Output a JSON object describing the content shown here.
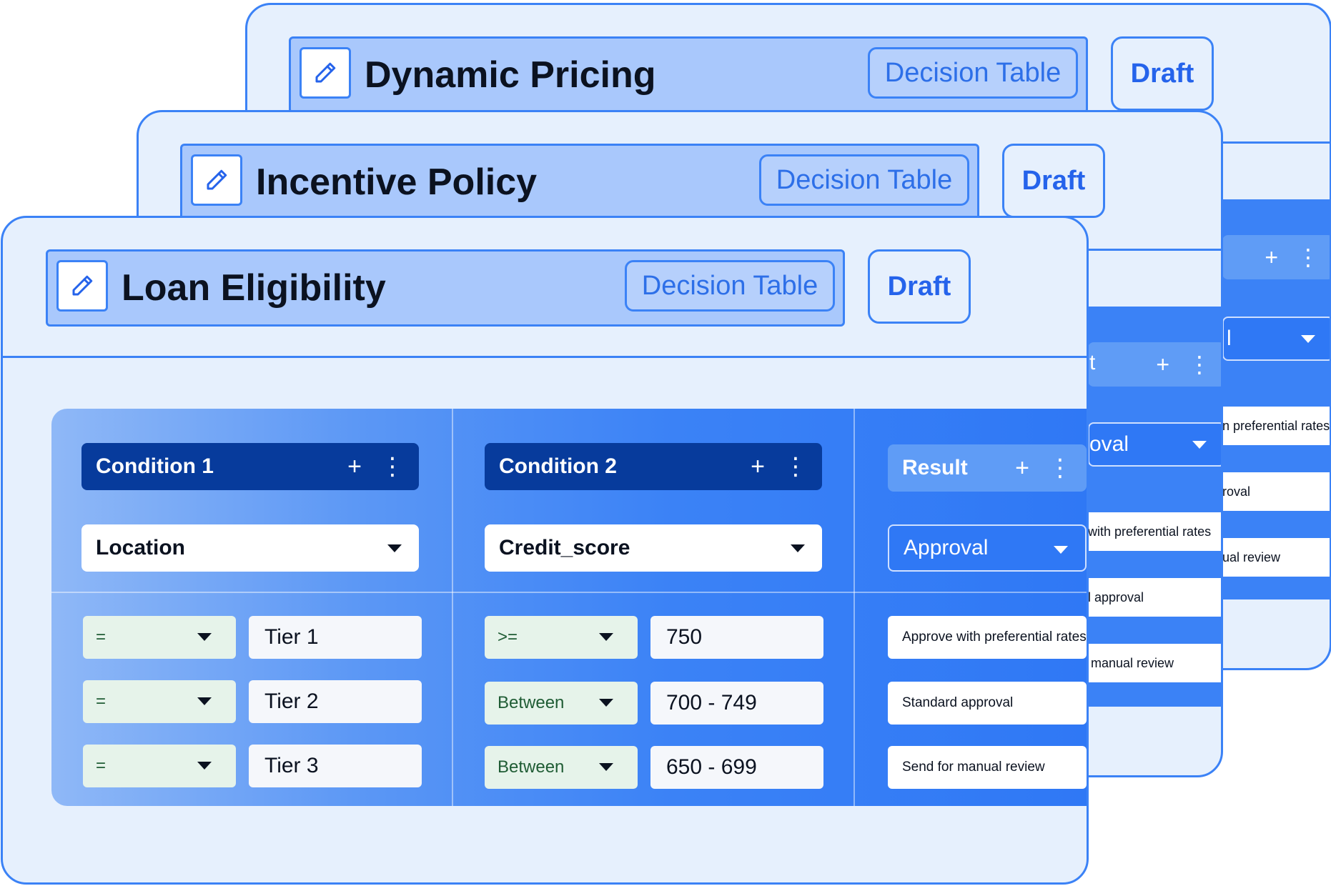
{
  "cards": {
    "back": {
      "title": "Dynamic Pricing",
      "type_label": "Decision Table",
      "status_label": "Draft",
      "peek": {
        "select_fragment": "l",
        "cells": [
          "n preferential rates",
          "roval",
          "ual review"
        ]
      }
    },
    "middle": {
      "title": "Incentive Policy",
      "type_label": "Decision Table",
      "status_label": "Draft",
      "peek": {
        "header_fragment": "t",
        "select_fragment": "oval",
        "cells": [
          "with preferential rates",
          "l approval",
          "manual review"
        ]
      }
    },
    "front": {
      "title": "Loan Eligibility",
      "type_label": "Decision Table",
      "status_label": "Draft"
    }
  },
  "table": {
    "columns": [
      {
        "header": "Condition 1",
        "field": "Location"
      },
      {
        "header": "Condition 2",
        "field": "Credit_score"
      },
      {
        "header": "Result",
        "field": "Approval"
      }
    ],
    "header_actions": {
      "add": "+",
      "more": "⋮"
    },
    "rows": [
      {
        "op1": "=",
        "val1": "Tier 1",
        "op2": ">=",
        "val2": "750",
        "result": "Approve with preferential rates"
      },
      {
        "op1": "=",
        "val1": "Tier 2",
        "op2": "Between",
        "val2": "700 - 749",
        "result": "Standard approval"
      },
      {
        "op1": "=",
        "val1": "Tier 3",
        "op2": "Between",
        "val2": "650 - 699",
        "result": "Send for manual review"
      }
    ]
  },
  "colors": {
    "accent": "#3b82f6",
    "header_dark": "#073b9c",
    "card_bg": "#e6f0fd",
    "title_bar": "#a9c8fc",
    "operator_bg": "#e6f3ea"
  },
  "icons": {
    "edit": "pencil-icon",
    "caret": "chevron-down-icon",
    "add": "plus-icon",
    "more": "kebab-menu-icon"
  }
}
